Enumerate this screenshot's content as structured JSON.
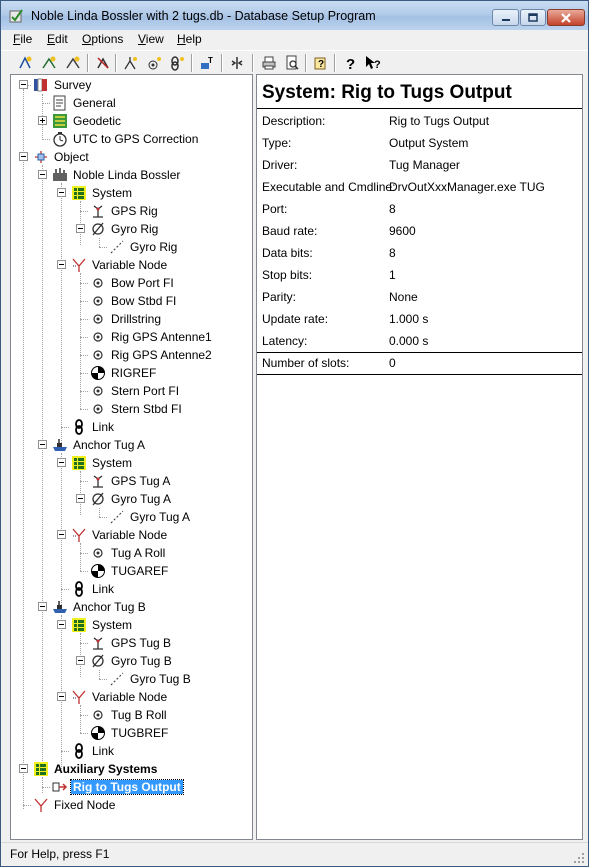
{
  "window": {
    "title": "Noble Linda Bossler with 2 tugs.db - Database Setup Program"
  },
  "menu": [
    {
      "label": "File",
      "accel": "F",
      "rest": "ile"
    },
    {
      "label": "Edit",
      "accel": "E",
      "rest": "dit"
    },
    {
      "label": "Options",
      "accel": "O",
      "rest": "ptions"
    },
    {
      "label": "View",
      "accel": "V",
      "rest": "iew"
    },
    {
      "label": "Help",
      "accel": "H",
      "rest": "elp"
    }
  ],
  "toolbar": {
    "buttons": [
      "add-survey-icon",
      "add-object-icon",
      "add-system-icon",
      "delete-icon",
      "add-node-icon",
      "add-point-icon",
      "add-link-icon",
      "settings-icon",
      "transfer-icon",
      "print-icon",
      "print-preview-icon",
      "context-help-icon",
      "about-icon",
      "whats-this-icon"
    ]
  },
  "tree": {
    "items": [
      {
        "label": "Survey",
        "icon": "survey-icon"
      },
      {
        "label": "General",
        "icon": "document-icon"
      },
      {
        "label": "Geodetic",
        "icon": "geodetic-icon"
      },
      {
        "label": "UTC to GPS Correction",
        "icon": "clock-icon"
      },
      {
        "label": "Object",
        "icon": "object-icon"
      },
      {
        "label": "Noble Linda Bossler",
        "icon": "rig-icon"
      },
      {
        "label": "System",
        "icon": "system-icon"
      },
      {
        "label": "GPS Rig",
        "icon": "gps-icon"
      },
      {
        "label": "Gyro Rig",
        "icon": "gyro-icon"
      },
      {
        "label": "Gyro Rig",
        "icon": "gyro-sub-icon"
      },
      {
        "label": "Variable Node",
        "icon": "variable-node-icon"
      },
      {
        "label": "Bow Port FI",
        "icon": "node-point-icon"
      },
      {
        "label": "Bow Stbd FI",
        "icon": "node-point-icon"
      },
      {
        "label": "Drillstring",
        "icon": "node-point-icon"
      },
      {
        "label": "Rig GPS Antenne1",
        "icon": "node-point-icon"
      },
      {
        "label": "Rig GPS Antenne2",
        "icon": "node-point-icon"
      },
      {
        "label": "RIGREF",
        "icon": "reference-icon"
      },
      {
        "label": "Stern Port FI",
        "icon": "node-point-icon"
      },
      {
        "label": "Stern Stbd FI",
        "icon": "node-point-icon"
      },
      {
        "label": "Link",
        "icon": "link-icon"
      },
      {
        "label": "Anchor Tug A",
        "icon": "tug-icon"
      },
      {
        "label": "System",
        "icon": "system-icon"
      },
      {
        "label": "GPS Tug A",
        "icon": "gps-icon"
      },
      {
        "label": "Gyro Tug A",
        "icon": "gyro-icon"
      },
      {
        "label": "Gyro Tug A",
        "icon": "gyro-sub-icon"
      },
      {
        "label": "Variable Node",
        "icon": "variable-node-icon"
      },
      {
        "label": "Tug A Roll",
        "icon": "node-point-icon"
      },
      {
        "label": "TUGAREF",
        "icon": "reference-icon"
      },
      {
        "label": "Link",
        "icon": "link-icon"
      },
      {
        "label": "Anchor Tug B",
        "icon": "tug-icon"
      },
      {
        "label": "System",
        "icon": "system-icon"
      },
      {
        "label": "GPS Tug B",
        "icon": "gps-icon"
      },
      {
        "label": "Gyro Tug B",
        "icon": "gyro-icon"
      },
      {
        "label": "Gyro Tug B",
        "icon": "gyro-sub-icon"
      },
      {
        "label": "Variable Node",
        "icon": "variable-node-icon"
      },
      {
        "label": "Tug B Roll",
        "icon": "node-point-icon"
      },
      {
        "label": "TUGBREF",
        "icon": "reference-icon"
      },
      {
        "label": "Link",
        "icon": "link-icon"
      },
      {
        "label": "Auxiliary Systems",
        "icon": "system-icon"
      },
      {
        "label": "Rig to Tugs Output",
        "icon": "output-icon"
      },
      {
        "label": "Fixed Node",
        "icon": "fixed-node-icon"
      }
    ]
  },
  "detail": {
    "title": "System: Rig to Tugs Output",
    "properties": [
      {
        "label": "Description:",
        "value": "Rig to Tugs Output"
      },
      {
        "label": "Type:",
        "value": "Output System"
      },
      {
        "label": "Driver:",
        "value": "Tug Manager"
      },
      {
        "label": "Executable and Cmdline:",
        "value": "DrvOutXxxManager.exe TUG"
      },
      {
        "label": "Port:",
        "value": "8"
      },
      {
        "label": "Baud rate:",
        "value": "9600"
      },
      {
        "label": "Data bits:",
        "value": "8"
      },
      {
        "label": "Stop bits:",
        "value": "1"
      },
      {
        "label": "Parity:",
        "value": "None"
      },
      {
        "label": "Update rate:",
        "value": "1.000 s"
      },
      {
        "label": "Latency:",
        "value": "0.000 s"
      }
    ],
    "slots": {
      "label": "Number of slots:",
      "value": "0"
    }
  },
  "status": {
    "text": "For Help, press F1"
  },
  "colors": {
    "selection": "#3399ff",
    "titlebar": "#b9d1ea"
  }
}
